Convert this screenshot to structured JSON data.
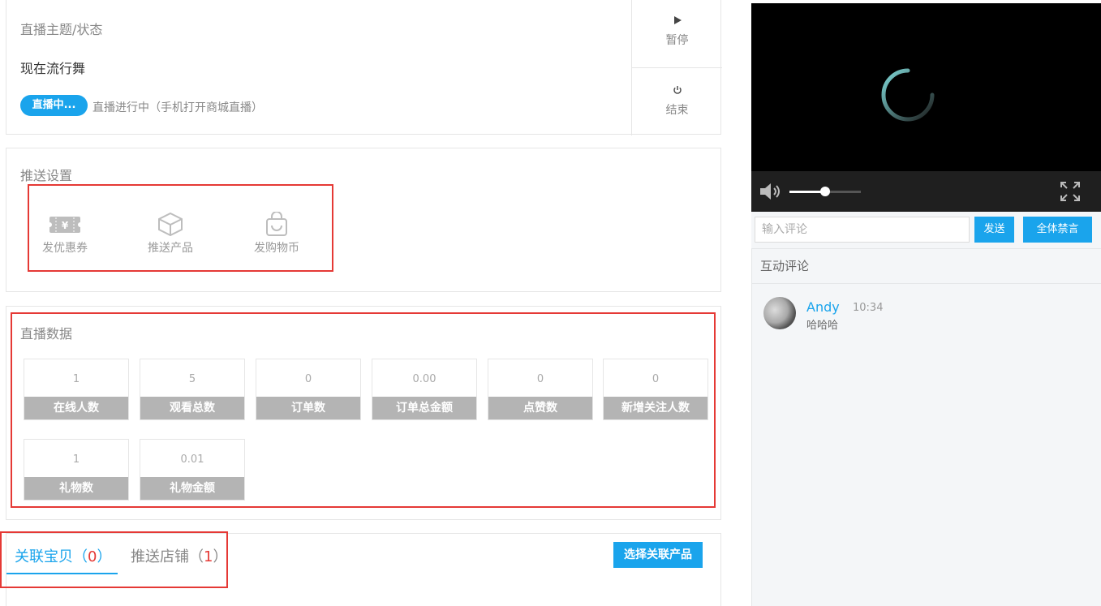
{
  "status": {
    "section_title": "直播主题/状态",
    "live_title": "现在流行舞",
    "badge": "直播中...",
    "description": "直播进行中（手机打开商城直播）",
    "pause": {
      "icon": "play-icon",
      "label": "暂停"
    },
    "end": {
      "icon": "power-icon",
      "label": "结束"
    }
  },
  "push": {
    "section_title": "推送设置",
    "items": [
      {
        "icon": "coupon-icon",
        "label": "发优惠券"
      },
      {
        "icon": "box-icon",
        "label": "推送产品"
      },
      {
        "icon": "shopping-bag-icon",
        "label": "发购物币"
      }
    ]
  },
  "live_data": {
    "section_title": "直播数据",
    "stats": [
      {
        "value": "1",
        "label": "在线人数"
      },
      {
        "value": "5",
        "label": "观看总数"
      },
      {
        "value": "0",
        "label": "订单数"
      },
      {
        "value": "0.00",
        "label": "订单总金额"
      },
      {
        "value": "0",
        "label": "点赞数"
      },
      {
        "value": "0",
        "label": "新增关注人数"
      },
      {
        "value": "1",
        "label": "礼物数"
      },
      {
        "value": "0.01",
        "label": "礼物金额"
      }
    ]
  },
  "tabs": [
    {
      "label": "关联宝贝（",
      "count": "0",
      "suffix": "）",
      "active": true
    },
    {
      "label": "推送店铺（",
      "count": "1",
      "suffix": "）",
      "active": false
    }
  ],
  "select_button": "选择关联产品",
  "player": {
    "volume_fraction": 0.5,
    "volume_icon": "speaker-icon",
    "fullscreen_icon": "fullscreen-icon",
    "loading_icon": "loading-spinner-icon"
  },
  "comment_bar": {
    "placeholder": "输入评论",
    "send": "发送",
    "mute_all": "全体禁言"
  },
  "comments": {
    "header": "互动评论",
    "items": [
      {
        "name": "Andy",
        "time": "10:34",
        "text": "哈哈哈"
      }
    ]
  },
  "colors": {
    "accent": "#1aa4ec",
    "highlight": "#e53935"
  }
}
